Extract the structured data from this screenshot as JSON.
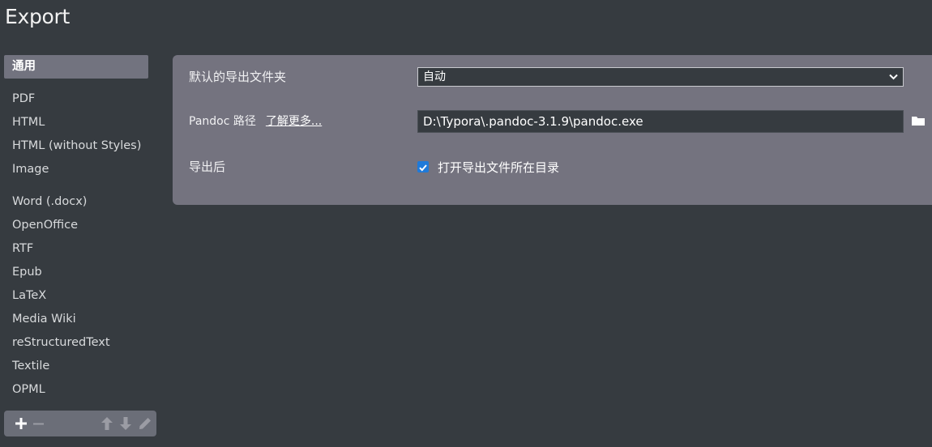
{
  "window": {
    "title": "Export"
  },
  "sidebar": {
    "items": [
      {
        "label": "通用",
        "active": true
      },
      {
        "label": "PDF"
      },
      {
        "label": "HTML"
      },
      {
        "label": "HTML (without Styles)"
      },
      {
        "label": "Image"
      },
      {
        "label": "Word (.docx)"
      },
      {
        "label": "OpenOffice"
      },
      {
        "label": "RTF"
      },
      {
        "label": "Epub"
      },
      {
        "label": "LaTeX"
      },
      {
        "label": "Media Wiki"
      },
      {
        "label": "reStructuredText"
      },
      {
        "label": "Textile"
      },
      {
        "label": "OPML"
      }
    ],
    "toolbar": {
      "add_icon": "plus-icon",
      "remove_icon": "minus-icon",
      "up_icon": "arrow-up-icon",
      "down_icon": "arrow-down-icon",
      "edit_icon": "pencil-icon"
    }
  },
  "settings": {
    "export_folder": {
      "label": "默认的导出文件夹",
      "value": "自动"
    },
    "pandoc": {
      "label": "Pandoc 路径",
      "link": "了解更多...",
      "value": "D:\\Typora\\.pandoc-3.1.9\\pandoc.exe"
    },
    "after_export": {
      "label": "导出后",
      "checkbox_label": "打开导出文件所在目录",
      "checked": true
    }
  },
  "colors": {
    "background": "#363b40",
    "panel": "#74737f",
    "active_item": "#72737f",
    "checkbox": "#1f7ad9"
  }
}
